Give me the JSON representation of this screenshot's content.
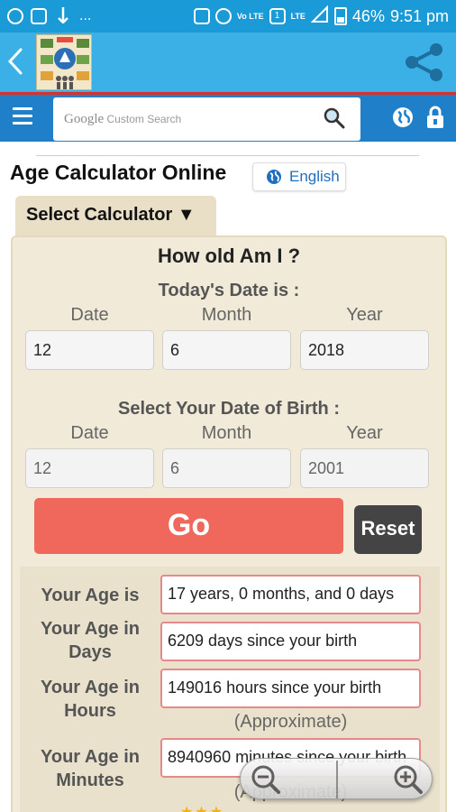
{
  "status_bar": {
    "ellipsis": "...",
    "battery_percent": "46%",
    "time": "9:51 pm",
    "volte": "Vo LTE",
    "lte": "LTE",
    "sim": "1"
  },
  "search": {
    "brand": "Google",
    "placeholder": "Custom Search"
  },
  "page": {
    "title": "Age Calculator Online",
    "language_button": "English",
    "select_calculator": "Select Calculator ▼"
  },
  "calculator": {
    "heading": "How old Am I ?",
    "today_label": "Today's Date is :",
    "dob_label": "Select Your Date of Birth :",
    "columns": [
      "Date",
      "Month",
      "Year"
    ],
    "today": {
      "date": "12",
      "month": "6",
      "year": "2018"
    },
    "dob": {
      "date": "12",
      "month": "6",
      "year": "2001"
    },
    "go_label": "Go",
    "reset_label": "Reset"
  },
  "results": {
    "age": {
      "label": "Your Age is",
      "value": "17 years, 0 months, and 0 days"
    },
    "days": {
      "label": "Your Age in Days",
      "value": "6209 days since your birth"
    },
    "hours": {
      "label": "Your Age in Hours",
      "value": "149016 hours since your birth",
      "note": "(Approximate)"
    },
    "minutes": {
      "label": "Your Age in Minutes",
      "value": "8940960 minutes since your birth",
      "note": "(Approximate)"
    }
  },
  "colors": {
    "status_bar": "#1a9bd7",
    "app_header": "#3bb0e6",
    "toolbar": "#1f80c9",
    "go_button": "#f0685c",
    "reset_button": "#444444",
    "panel": "#f1ead8"
  },
  "icons": {
    "status_left": [
      "whatsapp-icon",
      "gallery-icon",
      "download-icon"
    ],
    "status_right": [
      "alarm-icon",
      "wifi-icon",
      "signal-icon",
      "battery-icon"
    ]
  }
}
